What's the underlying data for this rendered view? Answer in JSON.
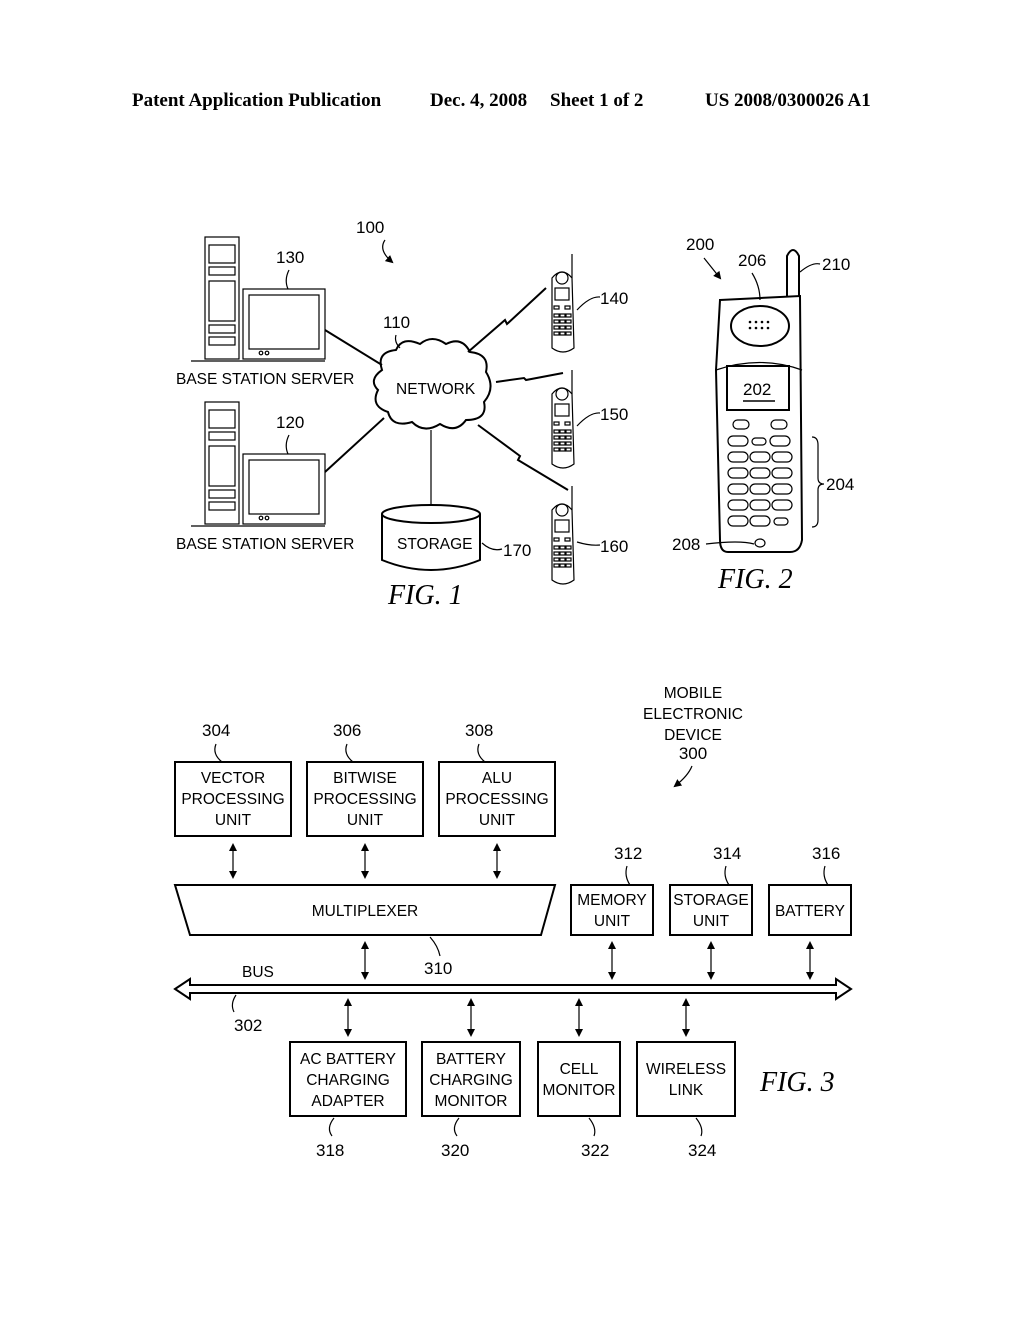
{
  "header": {
    "publication": "Patent Application Publication",
    "date": "Dec. 4, 2008",
    "sheet": "Sheet 1 of 2",
    "number": "US 2008/0300026 A1"
  },
  "fig1": {
    "caption": "FIG. 1",
    "ref_system": "100",
    "network": {
      "label": "NETWORK",
      "ref": "110"
    },
    "servers": [
      {
        "label": "BASE STATION SERVER",
        "ref": "130"
      },
      {
        "label": "BASE STATION SERVER",
        "ref": "120"
      }
    ],
    "storage": {
      "label": "STORAGE",
      "ref": "170"
    },
    "phones": [
      {
        "ref": "140"
      },
      {
        "ref": "150"
      },
      {
        "ref": "160"
      }
    ]
  },
  "fig2": {
    "caption": "FIG. 2",
    "ref_device": "200",
    "ref_display": "202",
    "ref_keypad": "204",
    "ref_speaker": "206",
    "ref_mic": "208",
    "ref_antenna": "210"
  },
  "fig3": {
    "caption": "FIG. 3",
    "device_title": [
      "MOBILE",
      "ELECTRONIC",
      "DEVICE"
    ],
    "device_ref": "300",
    "top_units": [
      {
        "ref": "304",
        "lines": [
          "VECTOR",
          "PROCESSING",
          "UNIT"
        ]
      },
      {
        "ref": "306",
        "lines": [
          "BITWISE",
          "PROCESSING",
          "UNIT"
        ]
      },
      {
        "ref": "308",
        "lines": [
          "ALU",
          "PROCESSING",
          "UNIT"
        ]
      }
    ],
    "multiplexer": {
      "label": "MULTIPLEXER",
      "ref": "310"
    },
    "right_units": [
      {
        "ref": "312",
        "lines": [
          "MEMORY",
          "UNIT"
        ]
      },
      {
        "ref": "314",
        "lines": [
          "STORAGE",
          "UNIT"
        ]
      },
      {
        "ref": "316",
        "lines": [
          "BATTERY"
        ]
      }
    ],
    "bus": {
      "label": "BUS",
      "ref": "302"
    },
    "bottom_units": [
      {
        "ref": "318",
        "lines": [
          "AC BATTERY",
          "CHARGING",
          "ADAPTER"
        ]
      },
      {
        "ref": "320",
        "lines": [
          "BATTERY",
          "CHARGING",
          "MONITOR"
        ]
      },
      {
        "ref": "322",
        "lines": [
          "CELL",
          "MONITOR"
        ]
      },
      {
        "ref": "324",
        "lines": [
          "WIRELESS",
          "LINK"
        ]
      }
    ]
  }
}
